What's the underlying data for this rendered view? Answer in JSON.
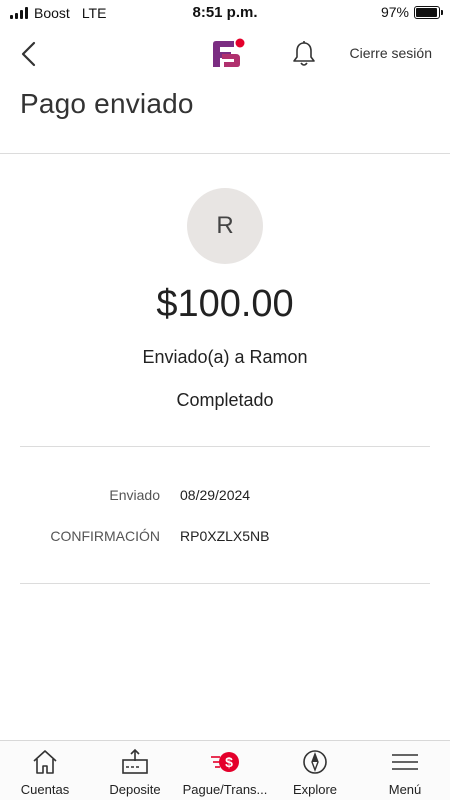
{
  "status_bar": {
    "carrier": "Boost",
    "network": "LTE",
    "time": "8:51 p.m.",
    "battery_text": "97%",
    "battery_level": 0.97
  },
  "header": {
    "logout_label": "Cierre sesión",
    "accent_color": "#e4002b",
    "logo_color": "#7b2d82"
  },
  "page": {
    "title": "Pago enviado"
  },
  "payment": {
    "recipient_initial": "R",
    "amount": "$100.00",
    "sent_to": "Enviado(a) a Ramon",
    "status": "Completado"
  },
  "details": [
    {
      "label": "Enviado",
      "value": "08/29/2024"
    },
    {
      "label": "CONFIRMACIÓN",
      "value": "RP0XZLX5NB"
    }
  ],
  "tabs": [
    {
      "label": "Cuentas",
      "icon": "home-icon"
    },
    {
      "label": "Deposite",
      "icon": "deposit-icon"
    },
    {
      "label": "Pague/Trans...",
      "icon": "pay-transfer-icon"
    },
    {
      "label": "Explore",
      "icon": "compass-icon"
    },
    {
      "label": "Menú",
      "icon": "menu-icon"
    }
  ]
}
